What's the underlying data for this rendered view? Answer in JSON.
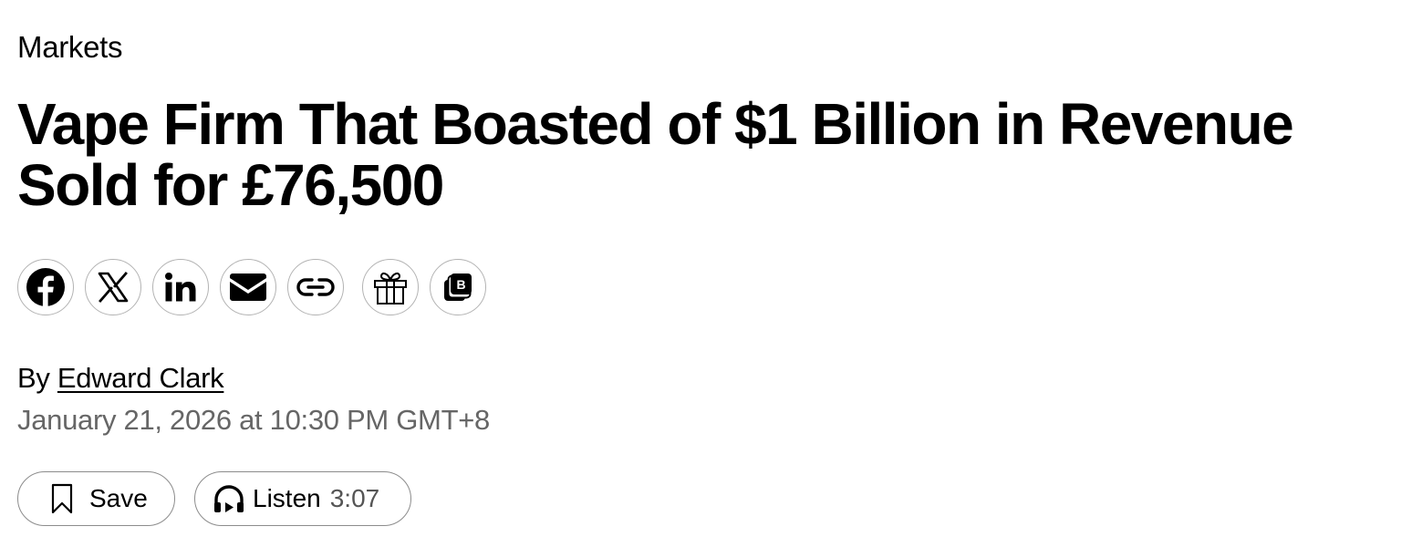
{
  "article": {
    "section": "Markets",
    "headline": "Vape Firm That Boasted of $1 Billion in Revenue Sold for £76,500",
    "byline_prefix": "By",
    "author": "Edward Clark",
    "timestamp": "January 21, 2026 at 10:30 PM GMT+8"
  },
  "share": {
    "icons": [
      {
        "name": "facebook-icon"
      },
      {
        "name": "x-icon"
      },
      {
        "name": "linkedin-icon"
      },
      {
        "name": "email-icon"
      },
      {
        "name": "link-icon"
      },
      {
        "name": "gift-icon"
      },
      {
        "name": "bloomberg-terminal-icon",
        "glyph": "B"
      }
    ]
  },
  "actions": {
    "save_label": "Save",
    "listen_label": "Listen",
    "listen_duration": "3:07"
  },
  "colors": {
    "text": "#000000",
    "muted": "#666666",
    "border": "#b3b3b3"
  }
}
